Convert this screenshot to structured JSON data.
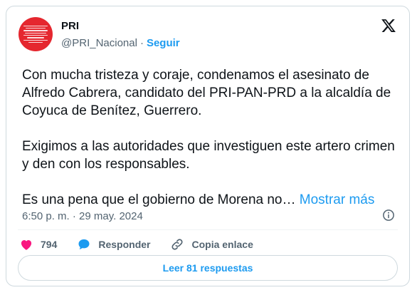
{
  "header": {
    "display_name": "PRI",
    "handle": "@PRI_Nacional",
    "separator": "·",
    "follow_label": "Seguir"
  },
  "tweet": {
    "paragraph_1": "Con mucha tristeza y coraje, condenamos el asesinato de Alfredo Cabrera, candidato del PRI-PAN-PRD a la alcaldía de Coyuca de Benítez, Guerrero.",
    "paragraph_2": "Exigimos a las autoridades que investiguen este artero crimen y den con los responsables.",
    "paragraph_3": "Es una pena que el gobierno de Morena no…",
    "show_more_label": "Mostrar más",
    "timestamp": "6:50 p. m. · 29 may. 2024"
  },
  "actions": {
    "like_count": "794",
    "reply_label": "Responder",
    "copy_link_label": "Copia enlace"
  },
  "footer": {
    "read_replies_label": "Leer 81 respuestas"
  },
  "colors": {
    "accent": "#1d9bf0",
    "like": "#f91880",
    "avatar_bg": "#e5272f"
  },
  "icons": [
    "x-logo-icon",
    "info-icon",
    "heart-icon",
    "reply-bubble-icon",
    "link-icon"
  ]
}
